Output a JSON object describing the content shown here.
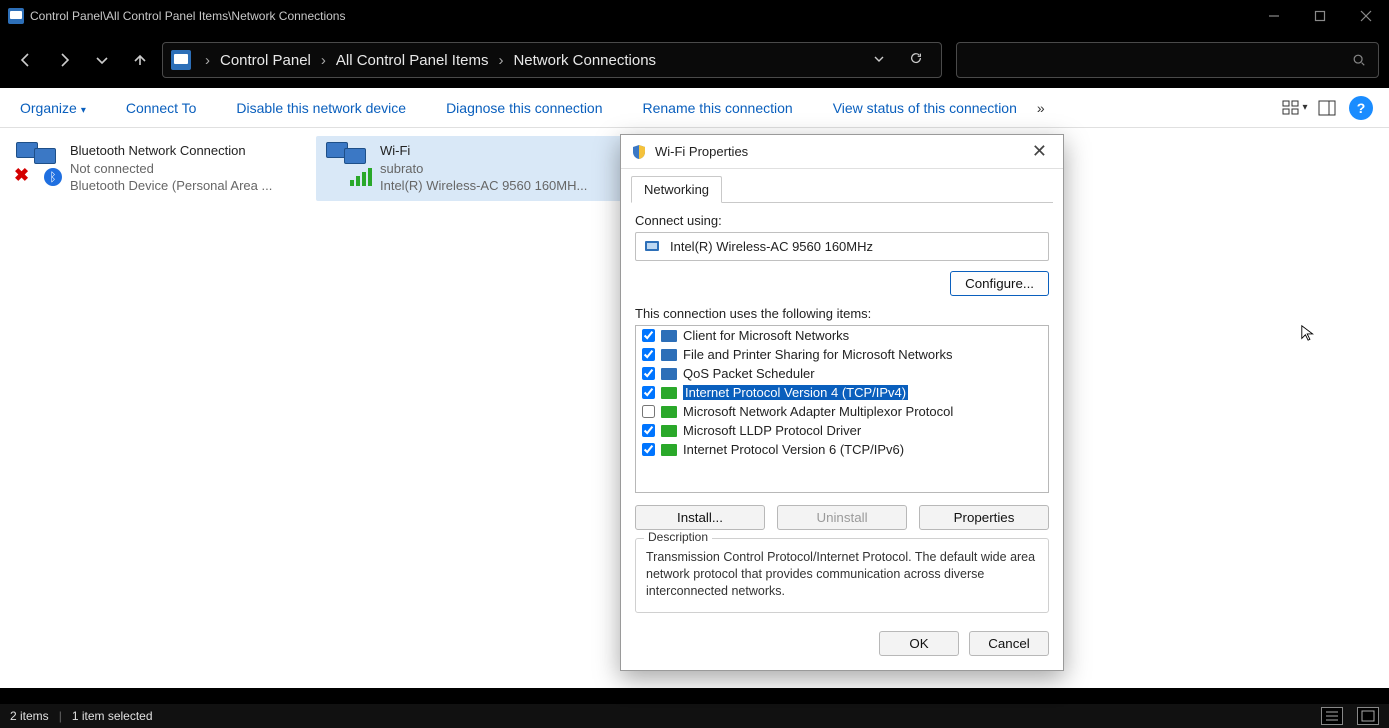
{
  "window": {
    "title": "Control Panel\\All Control Panel Items\\Network Connections"
  },
  "breadcrumb": {
    "items": [
      "Control Panel",
      "All Control Panel Items",
      "Network Connections"
    ]
  },
  "commands": {
    "organize": "Organize",
    "connect_to": "Connect To",
    "disable": "Disable this network device",
    "diagnose": "Diagnose this connection",
    "rename": "Rename this connection",
    "view_status": "View status of this connection",
    "overflow": "»"
  },
  "connections": [
    {
      "name": "Bluetooth Network Connection",
      "status": "Not connected",
      "device": "Bluetooth Device (Personal Area ...",
      "type": "bluetooth",
      "selected": false
    },
    {
      "name": "Wi-Fi",
      "status": "subrato",
      "device": "Intel(R) Wireless-AC 9560 160MH...",
      "type": "wifi",
      "selected": true
    }
  ],
  "statusbar": {
    "count": "2 items",
    "selected": "1 item selected"
  },
  "dialog": {
    "title": "Wi-Fi Properties",
    "tab": "Networking",
    "connect_using_label": "Connect using:",
    "adapter": "Intel(R) Wireless-AC 9560 160MHz",
    "configure": "Configure...",
    "items_label": "This connection uses the following items:",
    "items": [
      {
        "checked": true,
        "label": "Client for Microsoft Networks",
        "icon": "mon"
      },
      {
        "checked": true,
        "label": "File and Printer Sharing for Microsoft Networks",
        "icon": "mon"
      },
      {
        "checked": true,
        "label": "QoS Packet Scheduler",
        "icon": "mon"
      },
      {
        "checked": true,
        "label": "Internet Protocol Version 4 (TCP/IPv4)",
        "icon": "net",
        "selected": true
      },
      {
        "checked": false,
        "label": "Microsoft Network Adapter Multiplexor Protocol",
        "icon": "net"
      },
      {
        "checked": true,
        "label": "Microsoft LLDP Protocol Driver",
        "icon": "net"
      },
      {
        "checked": true,
        "label": "Internet Protocol Version 6 (TCP/IPv6)",
        "icon": "net"
      }
    ],
    "install": "Install...",
    "uninstall": "Uninstall",
    "properties": "Properties",
    "description_label": "Description",
    "description_text": "Transmission Control Protocol/Internet Protocol. The default wide area network protocol that provides communication across diverse interconnected networks.",
    "ok": "OK",
    "cancel": "Cancel"
  }
}
